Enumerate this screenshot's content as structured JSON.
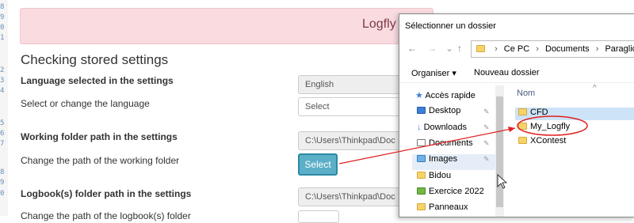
{
  "gutter": [
    "8",
    "9",
    "0",
    "1",
    "2",
    "3",
    "4",
    "5",
    "6",
    "7",
    "8",
    "9",
    "0"
  ],
  "banner": {
    "title": "Logfly"
  },
  "page": {
    "heading": "Checking stored settings",
    "language": {
      "label": "Language selected in the settings",
      "value": "English"
    },
    "language_change": {
      "label": "Select or change the language",
      "value": "Select"
    },
    "working_folder": {
      "label": "Working folder path in the settings",
      "value": "C:\\Users\\Thinkpad\\Doc"
    },
    "working_change": {
      "label": "Change the path of the working folder",
      "button": "Select"
    },
    "logbook_folder": {
      "label": "Logbook(s) folder path in the settings",
      "value": "C:\\Users\\Thinkpad\\Doc"
    },
    "logbook_change": {
      "label": "Change the path of the logbook(s) folder"
    }
  },
  "dialog": {
    "title": "Sélectionner un dossier",
    "nav": {
      "back": "←",
      "forward": "→",
      "recent": "⌄",
      "up": "↑"
    },
    "path": [
      "Ce PC",
      "Documents",
      "Paraglider"
    ],
    "path_prefix": "›",
    "commands": {
      "organize": "Organiser ▾",
      "new_folder": "Nouveau dossier"
    },
    "quick_access": [
      {
        "label": "Accès rapide",
        "icon": "star-icon"
      },
      {
        "label": "Desktop",
        "icon": "desktop-folder-icon",
        "pinned": true
      },
      {
        "label": "Downloads",
        "icon": "download-icon",
        "pinned": true
      },
      {
        "label": "Documents",
        "icon": "document-icon",
        "pinned": true
      },
      {
        "label": "Images",
        "icon": "images-icon",
        "pinned": true
      },
      {
        "label": "Bidou",
        "icon": "folder-icon"
      },
      {
        "label": "Exercice 2022",
        "icon": "excel-icon"
      },
      {
        "label": "Panneaux",
        "icon": "folder-icon"
      }
    ],
    "column_header": "Nom",
    "files": [
      {
        "label": "CFD",
        "selected": true
      },
      {
        "label": "My_Logfly",
        "selected": false
      },
      {
        "label": "XContest",
        "selected": false
      }
    ]
  },
  "colors": {
    "banner_bg": "#f9dbe0",
    "button": "#5bafc6",
    "annotation": "#e02020"
  }
}
